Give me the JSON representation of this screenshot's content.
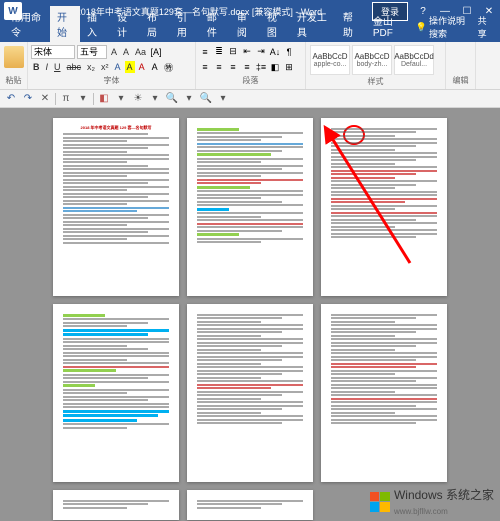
{
  "titlebar": {
    "title": "2018年中考语文真题129套—名句默写.docx [兼容模式] - Word",
    "login": "登录",
    "min": "—",
    "max": "☐",
    "close": "✕",
    "help": "?"
  },
  "tabs": {
    "items": [
      "常用命令",
      "开始",
      "插入",
      "设计",
      "布局",
      "引用",
      "邮件",
      "审阅",
      "视图",
      "开发工具",
      "帮助",
      "金山PDF"
    ],
    "active_index": 1,
    "right": [
      "操作说明搜索",
      "共享"
    ]
  },
  "ribbon": {
    "clipboard": {
      "label": "粘贴"
    },
    "font": {
      "family": "宋体",
      "size": "五号",
      "label": "字体",
      "grow": "A",
      "shrink": "A",
      "clear": "Aa",
      "bold": "B",
      "italic": "I",
      "underline": "U",
      "strike": "abc",
      "sub": "x₂",
      "sup": "x²",
      "effects": "A",
      "highlight": "A",
      "color": "A"
    },
    "paragraph": {
      "label": "段落"
    },
    "styles": {
      "label": "样式",
      "items": [
        {
          "preview": "AaBbCcD",
          "name": "apple-co..."
        },
        {
          "preview": "AaBbCcD",
          "name": "body-zh..."
        },
        {
          "preview": "AaBbCcDd",
          "name": "Defaul..."
        }
      ]
    },
    "editing": {
      "label": "编辑"
    }
  },
  "qat": {
    "items": [
      "↶",
      "↷",
      "✕",
      "▾",
      "π",
      "▾",
      "◧",
      "▾",
      "☀",
      "▾",
      "🔍",
      "▾",
      "🔍",
      "▾"
    ]
  },
  "document": {
    "page1_title": "2018 年中考语文真题 129 套—名句默写"
  },
  "watermark": {
    "brand": "Windows",
    "sub": "系统之家",
    "url": "www.bjfllw.com"
  }
}
